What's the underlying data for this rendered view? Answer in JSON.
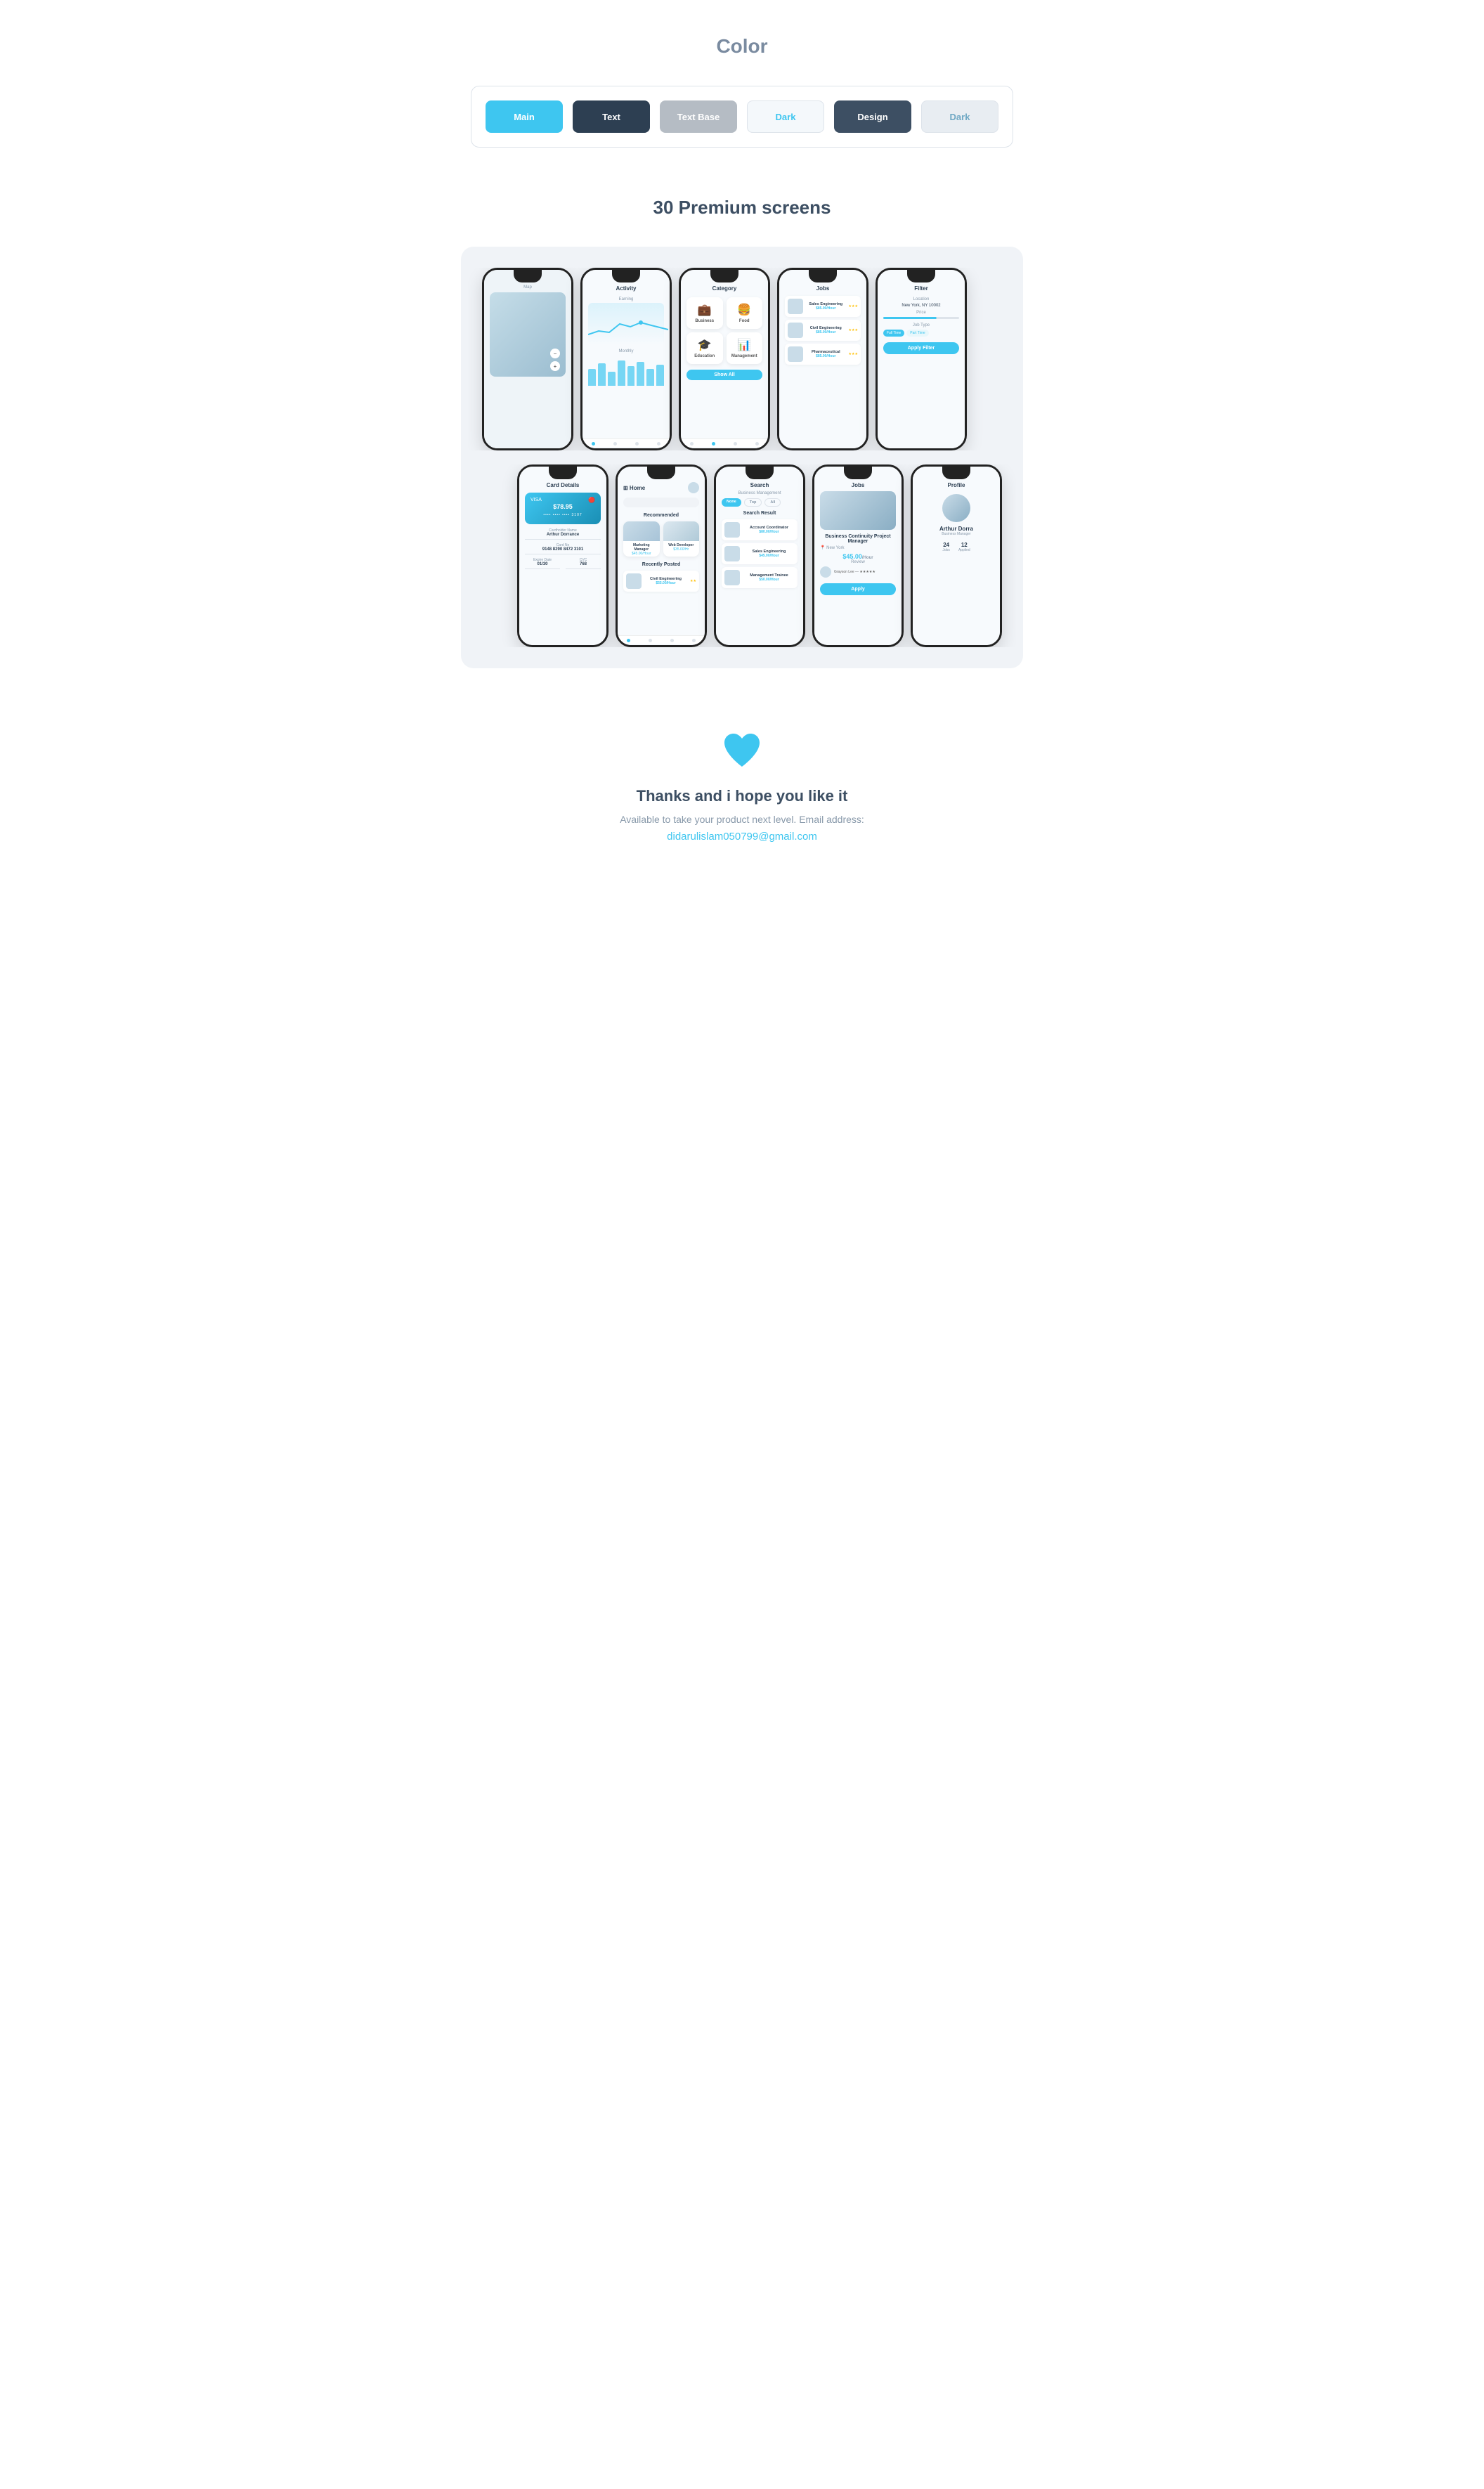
{
  "color_section": {
    "title": "Color",
    "swatches": [
      {
        "label": "Main",
        "class": "main"
      },
      {
        "label": "Text",
        "class": "text"
      },
      {
        "label": "Text Base",
        "class": "textbase"
      },
      {
        "label": "Dark",
        "class": "dark1"
      },
      {
        "label": "Design",
        "class": "design"
      },
      {
        "label": "Dark",
        "class": "dark2"
      }
    ]
  },
  "screens_section": {
    "title": "30 Premium screens"
  },
  "thanks_section": {
    "title": "Thanks and i hope you like it",
    "subtitle": "Available to take your product next level. Email address:",
    "email": "didarulislam050799@gmail.com"
  },
  "phone_screens": {
    "row1": [
      {
        "id": "activity",
        "label": "Activity"
      },
      {
        "id": "category",
        "label": "Category"
      },
      {
        "id": "jobs-list",
        "label": "Jobs"
      },
      {
        "id": "filter",
        "label": "Filter"
      }
    ],
    "row2": [
      {
        "id": "card",
        "label": "Card Details"
      },
      {
        "id": "home",
        "label": "Home"
      },
      {
        "id": "search",
        "label": "Search"
      },
      {
        "id": "jobs-detail",
        "label": "Jobs"
      },
      {
        "id": "profile",
        "label": "Profile"
      }
    ]
  }
}
